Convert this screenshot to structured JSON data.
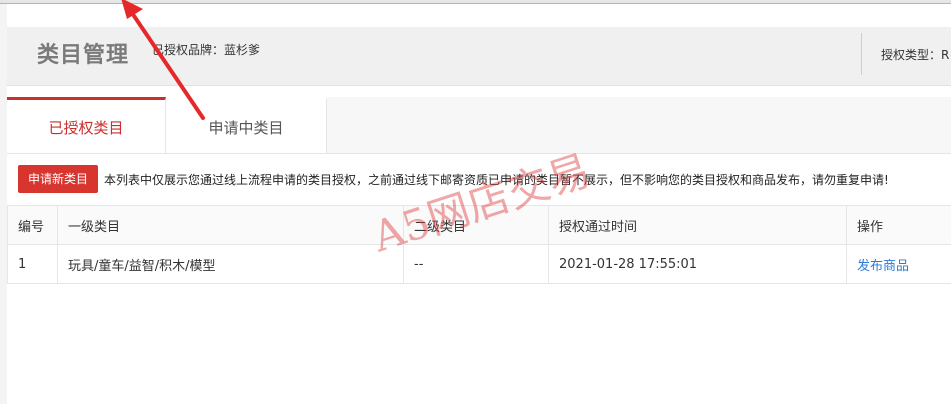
{
  "header": {
    "title": "类目管理",
    "brand_label": "已授权品牌：蓝杉爹",
    "auth_type_label": "授权类型：R"
  },
  "tabs": [
    {
      "label": "已授权类目",
      "active": true
    },
    {
      "label": "申请中类目",
      "active": false
    }
  ],
  "actions": {
    "apply_label": "申请新类目",
    "notice": "本列表中仅展示您通过线上流程申请的类目授权，之前通过线下邮寄资质已申请的类目暂不展示，但不影响您的类目授权和商品发布，请勿重复申请!"
  },
  "table": {
    "columns": [
      "编号",
      "一级类目",
      "二级类目",
      "授权通过时间",
      "操作"
    ],
    "rows": [
      {
        "id": "1",
        "level1": "玩具/童车/益智/积木/模型",
        "level2": "--",
        "time": "2021-01-28 17:55:01",
        "action": "发布商品"
      }
    ]
  },
  "watermark": "A5网店交易",
  "colors": {
    "accent": "#c9302c",
    "button": "#d9352f",
    "link": "#2d7bd3",
    "header_bg": "#f0f0f0"
  }
}
